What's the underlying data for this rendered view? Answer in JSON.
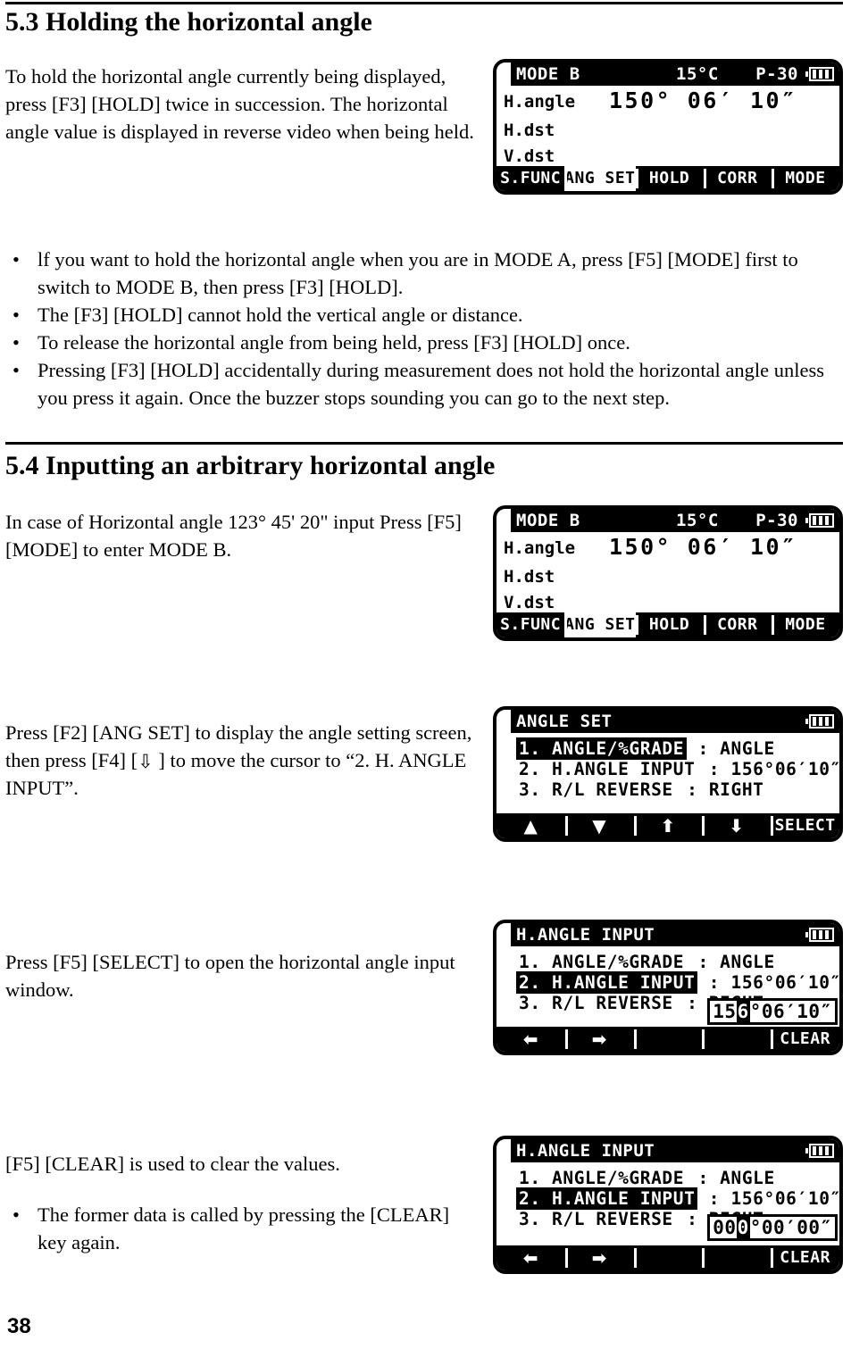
{
  "page": {
    "number": "38"
  },
  "sections": {
    "s53": {
      "heading": "5.3 Holding the horizontal angle",
      "intro": "To hold the horizontal angle currently being displayed, press [F3] [HOLD] twice in succession. The horizontal angle value is displayed in reverse video when being held.",
      "bullets": [
        "lf you want to hold the horizontal angle when you are in MODE A, press [F5] [MODE] first to switch to MODE B, then press [F3] [HOLD].",
        "The [F3] [HOLD] cannot hold the vertical angle or distance.",
        "To release the horizontal angle from being held, press [F3] [HOLD] once.",
        "Pressing [F3] [HOLD] accidentally during measurement does not hold the horizontal angle unless you press it again. Once the buzzer stops sounding you can go to the next step."
      ],
      "bullet_marker": "•"
    },
    "s54": {
      "heading": "5.4 Inputting an arbitrary horizontal angle",
      "intro": "In case of Horizontal angle 123° 45' 20\" input Press [F5] [MODE] to enter MODE B.",
      "step_angset_a": "Press [F2] [ANG SET] to display the angle setting screen, then press [F4] [",
      "step_angset_arrow": "⇩",
      "step_angset_b": " ] to move the cursor to “2. H. ANGLE INPUT”.",
      "step_select": "Press [F5] [SELECT] to open the horizontal angle input window.",
      "step_clear": "[F5] [CLEAR] is used to clear the values.",
      "bullets": [
        "The former data is called by pressing the [CLEAR] key again."
      ],
      "bullet_marker": "•"
    }
  },
  "screens": {
    "measure_mode_b": {
      "title": "MODE B",
      "temperature": "15°C",
      "pressure": "P-30",
      "battery": "battery-full-icon",
      "rows": [
        {
          "label": "H.angle",
          "value": "150° 06′ 10″"
        },
        {
          "label": "H.dst",
          "value": ""
        },
        {
          "label": "V.dst",
          "value": ""
        }
      ],
      "softkeys": [
        {
          "label": "S.FUNC",
          "inverted": false
        },
        {
          "label": "ANG SET",
          "inverted": true
        },
        {
          "label": "HOLD",
          "inverted": false
        },
        {
          "label": "CORR",
          "inverted": false
        },
        {
          "label": "MODE",
          "inverted": false
        }
      ]
    },
    "angle_set": {
      "title": "ANGLE SET",
      "battery": "battery-full-icon",
      "rows": [
        {
          "num": "1.",
          "name": "ANGLE/%GRADE",
          "sep": ":",
          "value": "ANGLE",
          "selected": true
        },
        {
          "num": "2.",
          "name": "H.ANGLE INPUT",
          "sep": ":",
          "value": "156°06′10″",
          "selected": false
        },
        {
          "num": "3.",
          "name": "R/L REVERSE",
          "sep": ":",
          "value": "RIGHT",
          "selected": false
        }
      ],
      "softkeys": [
        {
          "label": "▲",
          "glyph": true
        },
        {
          "label": "▼",
          "glyph": true
        },
        {
          "label": "⬆",
          "glyph": true
        },
        {
          "label": "⬇",
          "glyph": true
        },
        {
          "label": "SELECT",
          "glyph": false
        }
      ]
    },
    "h_angle_input": {
      "title": "H.ANGLE INPUT",
      "battery": "battery-full-icon",
      "rows": [
        {
          "num": "1.",
          "name": "ANGLE/%GRADE",
          "sep": ":",
          "value": "ANGLE",
          "selected": false
        },
        {
          "num": "2.",
          "name": "H.ANGLE INPUT",
          "sep": ":",
          "value": "156°06′10″",
          "selected": true
        },
        {
          "num": "3.",
          "name": "R/L REVERSE",
          "sep": ":",
          "value": "RIGHT",
          "selected": false
        }
      ],
      "input_window": {
        "before": "15",
        "cursor": "6",
        "after": "°06′10″"
      },
      "softkeys": [
        {
          "label": "⬅",
          "glyph": true
        },
        {
          "label": "➡",
          "glyph": true
        },
        {
          "label": "",
          "glyph": false
        },
        {
          "label": "",
          "glyph": false
        },
        {
          "label": "CLEAR",
          "glyph": false
        }
      ]
    },
    "h_angle_input_cleared": {
      "title": "H.ANGLE INPUT",
      "battery": "battery-full-icon",
      "rows": [
        {
          "num": "1.",
          "name": "ANGLE/%GRADE",
          "sep": ":",
          "value": "ANGLE",
          "selected": false
        },
        {
          "num": "2.",
          "name": "H.ANGLE INPUT",
          "sep": ":",
          "value": "156°06′10″",
          "selected": true
        },
        {
          "num": "3.",
          "name": "R/L REVERSE",
          "sep": ":",
          "value": "RIGHT",
          "selected": false
        }
      ],
      "input_window": {
        "before": "00",
        "cursor": "0",
        "after": "°00′00″"
      },
      "softkeys": [
        {
          "label": "⬅",
          "glyph": true
        },
        {
          "label": "➡",
          "glyph": true
        },
        {
          "label": "",
          "glyph": false
        },
        {
          "label": "",
          "glyph": false
        },
        {
          "label": "CLEAR",
          "glyph": false
        }
      ]
    }
  }
}
